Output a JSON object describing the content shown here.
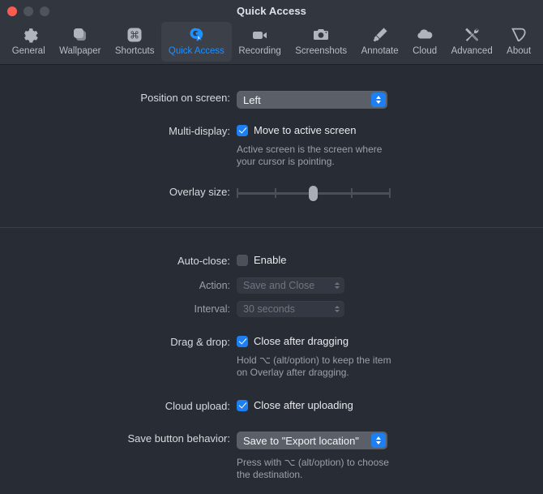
{
  "window": {
    "title": "Quick Access",
    "traffic": {
      "close": "close-button",
      "minimize": "minimize-button",
      "zoom": "zoom-button"
    }
  },
  "toolbar": {
    "items": [
      {
        "label": "General",
        "icon": "gear-icon",
        "selected": false
      },
      {
        "label": "Wallpaper",
        "icon": "wallpaper-icon",
        "selected": false
      },
      {
        "label": "Shortcuts",
        "icon": "command-key-icon",
        "selected": false
      },
      {
        "label": "Quick Access",
        "icon": "quick-access-icon",
        "selected": true
      },
      {
        "label": "Recording",
        "icon": "video-camera-icon",
        "selected": false
      },
      {
        "label": "Screenshots",
        "icon": "camera-icon",
        "selected": false
      },
      {
        "label": "Annotate",
        "icon": "marker-pen-icon",
        "selected": false
      },
      {
        "label": "Cloud",
        "icon": "cloud-icon",
        "selected": false
      },
      {
        "label": "Advanced",
        "icon": "tools-icon",
        "selected": false
      },
      {
        "label": "About",
        "icon": "tag-icon",
        "selected": false
      }
    ],
    "accent_color": "#1e90ff",
    "selected_bg": "#3c4049"
  },
  "settings": {
    "position": {
      "label": "Position on screen:",
      "value": "Left"
    },
    "multi_display": {
      "label": "Multi-display:",
      "checkbox_label": "Move to active screen",
      "checked": true,
      "hint": "Active screen is the screen where\nyour cursor is pointing."
    },
    "overlay_size": {
      "label": "Overlay size:",
      "min": 0,
      "max": 100,
      "value": 48,
      "ticks": [
        0,
        25,
        50,
        75,
        100
      ]
    },
    "auto_close": {
      "label": "Auto-close:",
      "checkbox_label": "Enable",
      "checked": false,
      "action": {
        "label": "Action:",
        "value": "Save and Close",
        "disabled": true
      },
      "interval": {
        "label": "Interval:",
        "value": "30 seconds",
        "disabled": true
      }
    },
    "drag_drop": {
      "label": "Drag & drop:",
      "checkbox_label": "Close after dragging",
      "checked": true,
      "hint": "Hold ⌥ (alt/option) to keep the item\non Overlay after dragging."
    },
    "cloud_upload": {
      "label": "Cloud upload:",
      "checkbox_label": "Close after uploading",
      "checked": true
    },
    "save_behavior": {
      "label": "Save button behavior:",
      "value": "Save to \"Export location\"",
      "hint": "Press with ⌥ (alt/option) to choose\nthe destination."
    }
  }
}
